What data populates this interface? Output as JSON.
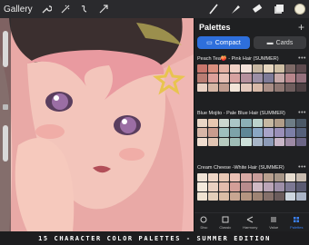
{
  "toolbar": {
    "gallery_label": "Gallery"
  },
  "palettes_panel": {
    "title": "Palettes",
    "tabs": [
      {
        "label": "Compact",
        "active": true
      },
      {
        "label": "Cards",
        "active": false
      }
    ],
    "palettes": [
      {
        "name": "Peach Tea🍑 - Pink Hair (SUMMER)",
        "colors": [
          "#c8766c",
          "#d98f7e",
          "#e3b1a3",
          "#f0d1c5",
          "#f3e2da",
          "#c7b7a2",
          "#e6d6bf",
          "#cfbfa4",
          "#7e6a67",
          "#5d4a4e",
          "#b97d73",
          "#dca09a",
          "#e7c1b6",
          "#d7a2a0",
          "#b5909d",
          "#9c8fa6",
          "#7e7b98",
          "#c8a9a9",
          "#b8868c",
          "#94707c",
          "#e9d1c3",
          "#d5b6a4",
          "#bf9c8e",
          "#f2e5d8",
          "#e4c9bd",
          "#d8b9a8",
          "#a98e86",
          "#8f7772",
          "#6f5d5d",
          "#4d4043"
        ]
      },
      {
        "name": "Blue Mojito - Pale Blue Hair (SUMMER)",
        "colors": [
          "#e9d6c6",
          "#e8c8b1",
          "#cbd6cf",
          "#abc6c7",
          "#8cb0b6",
          "#bcd3cd",
          "#c6b8a2",
          "#b19d89",
          "#6e7d86",
          "#4b5866",
          "#d8b6a7",
          "#c89c8e",
          "#9fbfbd",
          "#7da3a9",
          "#5f8796",
          "#8aa7c4",
          "#a8a4c9",
          "#9a8fb8",
          "#7c7fa7",
          "#55607a",
          "#f0ded0",
          "#e1c5b3",
          "#b7cabf",
          "#9ebcb6",
          "#cde0da",
          "#a8b6c8",
          "#8d9bb8",
          "#c9b6c8",
          "#9d8aa5",
          "#6b6585"
        ]
      },
      {
        "name": "Cream Cheese -White Hair (SUMMER)",
        "colors": [
          "#f0e3d6",
          "#efd7c7",
          "#e8c8b5",
          "#eac0b4",
          "#d7a9a4",
          "#c89d9a",
          "#b8a08f",
          "#a89788",
          "#e6dccf",
          "#c9bcb0",
          "#f4e9dc",
          "#ead1c1",
          "#e2bcad",
          "#d49f98",
          "#b88c8d",
          "#cfb9c3",
          "#bba5b7",
          "#9e8fa8",
          "#7c7893",
          "#5b5b72",
          "#efe2d1",
          "#e3cfba",
          "#dabda6",
          "#c8a692",
          "#b49581",
          "#9e8474",
          "#85706a",
          "#6b5c5c",
          "#cdd6df",
          "#aab4c6"
        ]
      }
    ],
    "nav": [
      {
        "label": "Disc",
        "active": false
      },
      {
        "label": "Classic",
        "active": false
      },
      {
        "label": "Harmony",
        "active": false
      },
      {
        "label": "Value",
        "active": false
      },
      {
        "label": "Palettes",
        "active": true
      }
    ]
  },
  "caption": "15 CHARACTER COLOR PALETTES - SUMMER EDITION"
}
